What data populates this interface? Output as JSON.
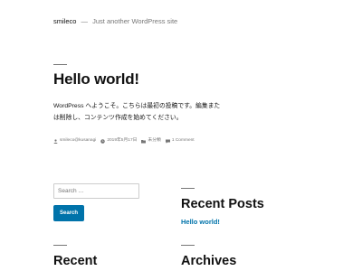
{
  "header": {
    "site_title": "smileco",
    "separator": "—",
    "tagline": "Just another WordPress site"
  },
  "post": {
    "title": "Hello world!",
    "content": "WordPress へようこそ。こちらは最初の投稿です。編集または削除し、コンテンツ作成を始めてください。",
    "meta": {
      "author": "smileco@kusanagi",
      "date": "2019年5月17日",
      "category": "未分類",
      "comments": "1 Comment"
    }
  },
  "search": {
    "placeholder": "Search …",
    "button_label": "Search"
  },
  "recent_posts": {
    "title": "Recent Posts",
    "items": [
      "Hello world!"
    ]
  },
  "recent_comments": {
    "title": "Recent"
  },
  "archives": {
    "title": "Archives"
  },
  "colors": {
    "accent": "#0073aa",
    "text": "#111111",
    "muted": "#767676"
  }
}
